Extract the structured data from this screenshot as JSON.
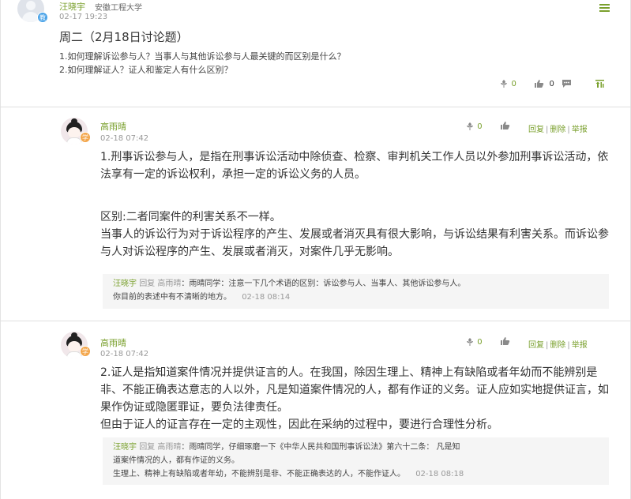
{
  "topic": {
    "author": "汪晓宇",
    "school": "安徽工程大学",
    "badge": "教",
    "time": "02-17 19:23",
    "title": "周二（2月18日讨论题）",
    "questions": [
      "1.如何理解诉讼参与人？当事人与其他诉讼参与人最关键的而区别是什么？",
      "2.如何理解证人？证人和鉴定人有什么区别？"
    ],
    "stats": {
      "flowers": "0",
      "likes": "0"
    },
    "icons": [
      "menu-icon",
      "flower-icon",
      "thumb-up-icon",
      "comment-icon",
      "pin-top-icon"
    ]
  },
  "replies": [
    {
      "author": "高雨晴",
      "badge": "学",
      "time": "02-18 07:42",
      "flowers": "0",
      "actions": {
        "reply": "回复",
        "delete": "删除",
        "report": "举报"
      },
      "body": [
        "1.刑事诉讼参与人，是指在刑事诉讼活动中除侦查、检察、审判机关工作人员以外参加刑事诉讼活动，依法享有一定的诉讼权利，承担一定的诉讼义务的人员。",
        "区别:二者同案件的利害关系不一样。",
        "当事人的诉讼行为对于诉讼程序的产生、发展或者消灭具有很大影响，与诉讼结果有利害关系。而诉讼参与人对诉讼程序的产生、发展或者消灭，对案件几乎无影响。"
      ],
      "comment": {
        "from": "汪晓宇",
        "reply_word": "回复",
        "to": "高雨晴",
        "text1": "：雨晴同学：注意一下几个术语的区别：诉讼参与人、当事人、其他诉讼参与人。",
        "text2": "你目前的表述中有不清晰的地方。",
        "time": "02-18 08:14"
      }
    },
    {
      "author": "高雨晴",
      "badge": "学",
      "time": "02-18 07:42",
      "flowers": "0",
      "actions": {
        "reply": "回复",
        "delete": "删除",
        "report": "举报"
      },
      "body": [
        "2.证人是指知道案件情况并提供证言的人。在我国，除因生理上、精神上有缺陷或者年幼而不能辨别是非、不能正确表达意志的人以外，凡是知道案件情况的人，都有作证的义务。证人应如实地提供证言，如果作伪证或隐匿罪证，要负法律责任。",
        "但由于证人的证言存在一定的主观性，因此在采纳的过程中，要进行合理性分析。"
      ],
      "comment": {
        "from": "汪晓宇",
        "reply_word": "回复",
        "to": "高雨晴",
        "text1": "：雨晴同学，仔细琢磨一下《中华人民共和国刑事诉讼法》第六十二条： 凡是知",
        "text2": "道案件情况的人，都有作证的义务。",
        "text3": "生理上、精神上有缺陷或者年幼，不能辨别是非、不能正确表达的人，不能作证人。",
        "time": "02-18 08:18"
      }
    }
  ]
}
